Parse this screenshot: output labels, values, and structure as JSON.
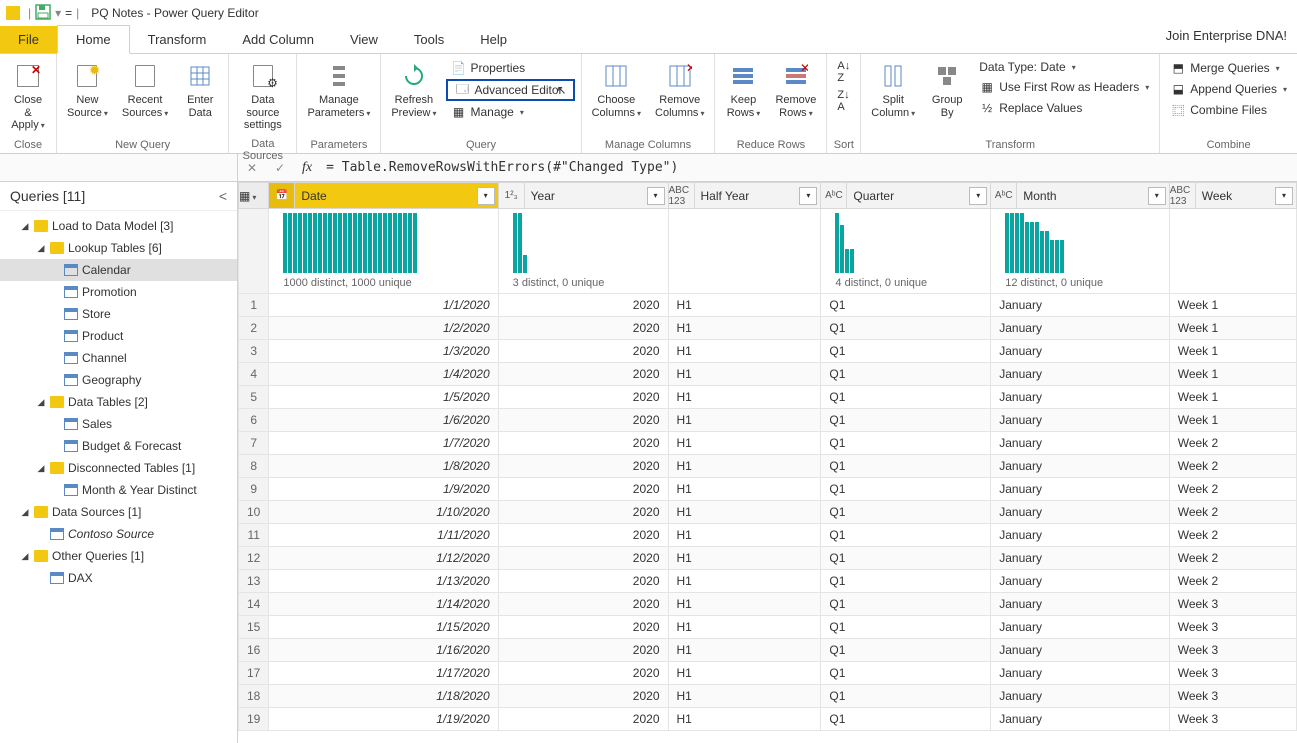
{
  "window": {
    "title": "PQ Notes - Power Query Editor",
    "top_right": "Join Enterprise DNA!"
  },
  "tabs": {
    "file": "File",
    "home": "Home",
    "transform": "Transform",
    "add_column": "Add Column",
    "view": "View",
    "tools": "Tools",
    "help": "Help"
  },
  "ribbon": {
    "close_apply": "Close &\nApply",
    "close_group": "Close",
    "new_source": "New\nSource",
    "recent_sources": "Recent\nSources",
    "enter_data": "Enter\nData",
    "new_query_group": "New Query",
    "data_source_settings": "Data source\nsettings",
    "data_sources_group": "Data Sources",
    "manage_parameters": "Manage\nParameters",
    "parameters_group": "Parameters",
    "refresh_preview": "Refresh\nPreview",
    "properties": "Properties",
    "advanced_editor": "Advanced Editor",
    "manage": "Manage",
    "query_group": "Query",
    "choose_columns": "Choose\nColumns",
    "remove_columns": "Remove\nColumns",
    "manage_columns_group": "Manage Columns",
    "keep_rows": "Keep\nRows",
    "remove_rows": "Remove\nRows",
    "reduce_rows_group": "Reduce Rows",
    "sort_group": "Sort",
    "split_column": "Split\nColumn",
    "group_by": "Group\nBy",
    "data_type": "Data Type: Date",
    "first_row_headers": "Use First Row as Headers",
    "replace_values": "Replace Values",
    "transform_group": "Transform",
    "merge_queries": "Merge Queries",
    "append_queries": "Append Queries",
    "combine_files": "Combine Files",
    "combine_group": "Combine"
  },
  "formula": "= Table.RemoveRowsWithErrors(#\"Changed Type\")",
  "queries_panel": {
    "title": "Queries [11]",
    "groups": [
      {
        "label": "Load to Data Model [3]",
        "type": "folder",
        "level": 0
      },
      {
        "label": "Lookup Tables [6]",
        "type": "folder",
        "level": 1
      },
      {
        "label": "Calendar",
        "type": "table",
        "level": 2,
        "selected": true
      },
      {
        "label": "Promotion",
        "type": "table",
        "level": 2
      },
      {
        "label": "Store",
        "type": "table",
        "level": 2
      },
      {
        "label": "Product",
        "type": "table",
        "level": 2
      },
      {
        "label": "Channel",
        "type": "table",
        "level": 2
      },
      {
        "label": "Geography",
        "type": "table",
        "level": 2
      },
      {
        "label": "Data Tables [2]",
        "type": "folder",
        "level": 1
      },
      {
        "label": "Sales",
        "type": "table",
        "level": 2
      },
      {
        "label": "Budget & Forecast",
        "type": "table",
        "level": 2
      },
      {
        "label": "Disconnected Tables [1]",
        "type": "folder",
        "level": 1
      },
      {
        "label": "Month & Year Distinct",
        "type": "table",
        "level": 2
      },
      {
        "label": "Data Sources [1]",
        "type": "folder",
        "level": 0
      },
      {
        "label": "Contoso Source",
        "type": "table",
        "level": 1,
        "italic": true
      },
      {
        "label": "Other Queries [1]",
        "type": "folder",
        "level": 0
      },
      {
        "label": "DAX",
        "type": "table",
        "level": 1
      }
    ]
  },
  "columns": [
    {
      "name": "Date",
      "type_icon": "📅",
      "stats": "1000 distinct, 1000 unique",
      "highlighted": true
    },
    {
      "name": "Year",
      "type_icon": "1²₃",
      "stats": "3 distinct, 0 unique"
    },
    {
      "name": "Half Year",
      "type_icon": "ABC\n123",
      "stats": ""
    },
    {
      "name": "Quarter",
      "type_icon": "AᵇC",
      "stats": "4 distinct, 0 unique"
    },
    {
      "name": "Month",
      "type_icon": "AᵇC",
      "stats": "12 distinct, 0 unique"
    },
    {
      "name": "Week",
      "type_icon": "ABC\n123",
      "stats": ""
    }
  ],
  "chart_data": {
    "type": "bar",
    "note": "column profile mini-histograms; heights below are relative fractions of full bar height",
    "series": [
      {
        "name": "Date",
        "bars": [
          1,
          1,
          1,
          1,
          1,
          1,
          1,
          1,
          1,
          1,
          1,
          1,
          1,
          1,
          1,
          1,
          1,
          1,
          1,
          1,
          1,
          1,
          1,
          1,
          1,
          1,
          1
        ]
      },
      {
        "name": "Year",
        "bars": [
          1,
          1,
          0.3
        ]
      },
      {
        "name": "Half Year",
        "bars": []
      },
      {
        "name": "Quarter",
        "bars": [
          1,
          0.8,
          0.4,
          0.4
        ]
      },
      {
        "name": "Month",
        "bars": [
          1,
          1,
          1,
          1,
          0.85,
          0.85,
          0.85,
          0.7,
          0.7,
          0.55,
          0.55,
          0.55
        ]
      },
      {
        "name": "Week",
        "bars": []
      }
    ]
  },
  "rows": [
    {
      "n": 1,
      "date": "1/1/2020",
      "year": "2020",
      "half": "H1",
      "q": "Q1",
      "month": "January",
      "week": "Week 1"
    },
    {
      "n": 2,
      "date": "1/2/2020",
      "year": "2020",
      "half": "H1",
      "q": "Q1",
      "month": "January",
      "week": "Week 1"
    },
    {
      "n": 3,
      "date": "1/3/2020",
      "year": "2020",
      "half": "H1",
      "q": "Q1",
      "month": "January",
      "week": "Week 1"
    },
    {
      "n": 4,
      "date": "1/4/2020",
      "year": "2020",
      "half": "H1",
      "q": "Q1",
      "month": "January",
      "week": "Week 1"
    },
    {
      "n": 5,
      "date": "1/5/2020",
      "year": "2020",
      "half": "H1",
      "q": "Q1",
      "month": "January",
      "week": "Week 1"
    },
    {
      "n": 6,
      "date": "1/6/2020",
      "year": "2020",
      "half": "H1",
      "q": "Q1",
      "month": "January",
      "week": "Week 1"
    },
    {
      "n": 7,
      "date": "1/7/2020",
      "year": "2020",
      "half": "H1",
      "q": "Q1",
      "month": "January",
      "week": "Week 2"
    },
    {
      "n": 8,
      "date": "1/8/2020",
      "year": "2020",
      "half": "H1",
      "q": "Q1",
      "month": "January",
      "week": "Week 2"
    },
    {
      "n": 9,
      "date": "1/9/2020",
      "year": "2020",
      "half": "H1",
      "q": "Q1",
      "month": "January",
      "week": "Week 2"
    },
    {
      "n": 10,
      "date": "1/10/2020",
      "year": "2020",
      "half": "H1",
      "q": "Q1",
      "month": "January",
      "week": "Week 2"
    },
    {
      "n": 11,
      "date": "1/11/2020",
      "year": "2020",
      "half": "H1",
      "q": "Q1",
      "month": "January",
      "week": "Week 2"
    },
    {
      "n": 12,
      "date": "1/12/2020",
      "year": "2020",
      "half": "H1",
      "q": "Q1",
      "month": "January",
      "week": "Week 2"
    },
    {
      "n": 13,
      "date": "1/13/2020",
      "year": "2020",
      "half": "H1",
      "q": "Q1",
      "month": "January",
      "week": "Week 2"
    },
    {
      "n": 14,
      "date": "1/14/2020",
      "year": "2020",
      "half": "H1",
      "q": "Q1",
      "month": "January",
      "week": "Week 3"
    },
    {
      "n": 15,
      "date": "1/15/2020",
      "year": "2020",
      "half": "H1",
      "q": "Q1",
      "month": "January",
      "week": "Week 3"
    },
    {
      "n": 16,
      "date": "1/16/2020",
      "year": "2020",
      "half": "H1",
      "q": "Q1",
      "month": "January",
      "week": "Week 3"
    },
    {
      "n": 17,
      "date": "1/17/2020",
      "year": "2020",
      "half": "H1",
      "q": "Q1",
      "month": "January",
      "week": "Week 3"
    },
    {
      "n": 18,
      "date": "1/18/2020",
      "year": "2020",
      "half": "H1",
      "q": "Q1",
      "month": "January",
      "week": "Week 3"
    },
    {
      "n": 19,
      "date": "1/19/2020",
      "year": "2020",
      "half": "H1",
      "q": "Q1",
      "month": "January",
      "week": "Week 3"
    }
  ]
}
